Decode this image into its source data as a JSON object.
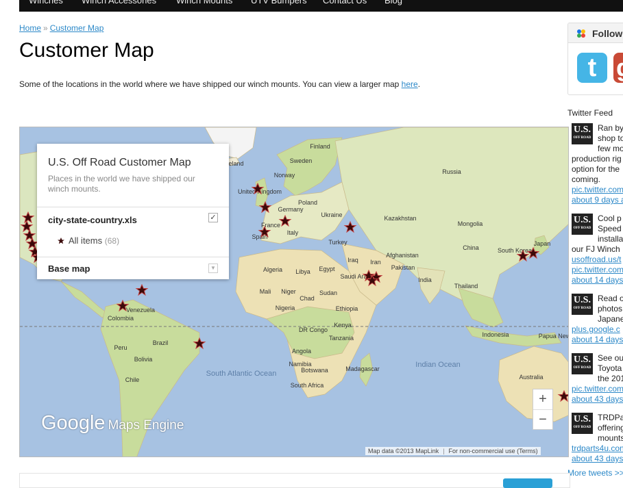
{
  "nav": {
    "items": [
      "Winches",
      "Winch Accessories",
      "Winch Mounts",
      "UTV Bumpers",
      "Contact Us",
      "Blog"
    ]
  },
  "breadcrumb": {
    "home": "Home",
    "sep": "»",
    "current": "Customer Map"
  },
  "page": {
    "title": "Customer Map",
    "intro_text": "Some of the locations in the world where we have shipped our winch mounts. You can view a larger map ",
    "intro_link": "here",
    "intro_end": "."
  },
  "map": {
    "panel": {
      "title": "U.S. Off Road Customer Map",
      "description": "Places in the world we have shipped our winch mounts.",
      "layer_name": "city-state-country.xls",
      "layer_checked": "✓",
      "all_items_label": "All items",
      "all_items_count": "(68)",
      "base_map_label": "Base map"
    },
    "labels": [
      "Iceland",
      "Finland",
      "Sweden",
      "Norway",
      "United Kingdom",
      "Russia",
      "Poland",
      "Germany",
      "Ukraine",
      "France",
      "Kazakhstan",
      "Mongolia",
      "Italy",
      "Spain",
      "Turkey",
      "China",
      "Japan",
      "South Korea",
      "Iraq",
      "Iran",
      "Afghanistan",
      "Algeria",
      "Libya",
      "Egypt",
      "Pakistan",
      "Saudi Arabia",
      "India",
      "Thailand",
      "Mali",
      "Niger",
      "Chad",
      "Sudan",
      "Nigeria",
      "Ethiopia",
      "Venezuela",
      "Colombia",
      "Indonesia",
      "Papua New",
      "DR Congo",
      "Kenya",
      "Tanzania",
      "Brazil",
      "Peru",
      "Angola",
      "Bolivia",
      "Namibia",
      "Madagascar",
      "Australia",
      "Botswana",
      "Chile",
      "South Africa",
      "South Atlantic Ocean",
      "Indian Ocean"
    ],
    "zoom_in": "+",
    "zoom_out": "−",
    "brand_google": "Google",
    "brand_product": "Maps Engine",
    "attribution_data": "Map data ©2013 MapLink",
    "attribution_use": "For non-commercial use (Terms)",
    "colors": {
      "ocean": "#a7c2e2",
      "land": "#f1ecd8",
      "forest": "#c8dc9c",
      "desert": "#ede1b5",
      "marker": "#8b1a1a"
    }
  },
  "sidebar": {
    "follow_label": "Follow",
    "twitter_letter": "t",
    "gplus_letter": "g",
    "feed_title": "Twitter Feed",
    "logo_top": "U.S.",
    "logo_bottom": "OFF ROAD",
    "tweets": [
      {
        "lines": [
          "Ran by",
          "shop to",
          "few mo",
          "production rig",
          "option for the",
          "coming."
        ],
        "links": [
          "pic.twitter.com",
          "about 9 days a"
        ]
      },
      {
        "lines": [
          "Cool p",
          "Speed",
          "installa",
          "our FJ Winch"
        ],
        "links": [
          "usoffroad.us/t",
          "pic.twitter.com",
          "about 14 days"
        ]
      },
      {
        "lines": [
          "Read o",
          "photos",
          "Japane"
        ],
        "links": [
          "plus.google.c",
          "about 14 days"
        ]
      },
      {
        "lines": [
          "See ou",
          "Toyota",
          "the 201"
        ],
        "links": [
          "pic.twitter.com",
          "about 43 days"
        ]
      },
      {
        "lines": [
          "TRDPa",
          "offering",
          "mounts"
        ],
        "links": [
          "trdparts4u.con",
          "about 43 days"
        ]
      }
    ],
    "more_tweets": "More tweets >>"
  }
}
